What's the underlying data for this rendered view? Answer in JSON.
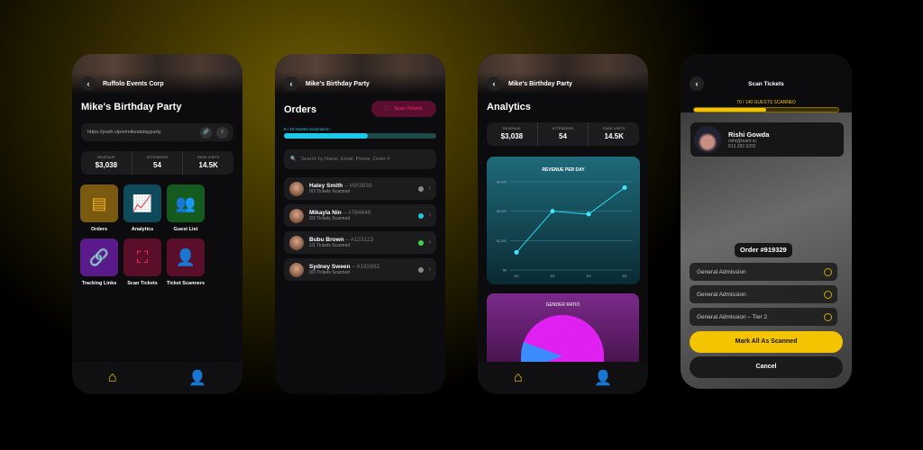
{
  "colors": {
    "accent": "#f5c400",
    "cyan": "#1fc8e8",
    "magenta": "#e020f0",
    "green": "#3ed14a"
  },
  "phone1": {
    "breadcrumb": "Ruffolo Events Corp",
    "title": "Mike's Birthday Party",
    "url": "https://posh.vip/e/mikesbdayparty",
    "stats": [
      {
        "label": "REVENUE",
        "value": "$3,038"
      },
      {
        "label": "ATTENDEES",
        "value": "54"
      },
      {
        "label": "PAGE VISITS",
        "value": "14.5K"
      }
    ],
    "tiles": [
      {
        "label": "Orders",
        "icon": "document-icon"
      },
      {
        "label": "Analytics",
        "icon": "chart-icon"
      },
      {
        "label": "Guest List",
        "icon": "people-icon"
      },
      {
        "label": "Tracking Links",
        "icon": "link-icon"
      },
      {
        "label": "Scan Tickets",
        "icon": "scan-icon"
      },
      {
        "label": "Ticket Scanners",
        "icon": "scanner-person-icon"
      }
    ]
  },
  "phone2": {
    "breadcrumb": "Mike's Birthday Party",
    "title": "Orders",
    "scan_button": "Scan Tickets",
    "progress_label": "8 / 18 Guests Scanned In",
    "progress": 0.55,
    "search_placeholder": "Search by Name, Email, Phone, Order #",
    "orders": [
      {
        "name": "Haley Smith",
        "order": "– #903939",
        "status": "0/3 Tickets Scanned",
        "dot": "#888888"
      },
      {
        "name": "Mikayla Nin",
        "order": "– #784646",
        "status": "2/3 Tickets Scanned",
        "dot": "#1fc8e8"
      },
      {
        "name": "Bubu Brown",
        "order": "– #123123",
        "status": "1/1 Tickets Scanned",
        "dot": "#3ed14a"
      },
      {
        "name": "Sydney Sween",
        "order": "– #192892",
        "status": "0/3 Tickets Scanned",
        "dot": "#888888"
      }
    ]
  },
  "phone3": {
    "breadcrumb": "Mike's Birthday Party",
    "title": "Analytics",
    "stats": [
      {
        "label": "REVENUE",
        "value": "$3,038"
      },
      {
        "label": "ATTENDEES",
        "value": "54"
      },
      {
        "label": "PAGE VISITS",
        "value": "14.5K"
      }
    ],
    "gender_title": "GENDER RATIO"
  },
  "chart_data": {
    "type": "line",
    "title": "REVENUE PER DAY",
    "categories": [
      "5/1",
      "5/2",
      "5/3",
      "5/4"
    ],
    "values": [
      600,
      2000,
      1900,
      3600
    ],
    "yticks": [
      0,
      1000,
      2000,
      4000
    ],
    "ytick_labels": [
      "$0",
      "$1,000",
      "$2,000",
      "$4,000"
    ],
    "ylim": [
      0,
      4000
    ],
    "grid": true
  },
  "phone4": {
    "title": "Scan Tickets",
    "progress_label": "70 / 140 GUESTS SCANNED",
    "progress": 0.5,
    "guest": {
      "name": "Rishi Gowda",
      "email": "rishi@team.vc",
      "phone": "813.282.9292"
    },
    "order": "Order #919329",
    "tickets": [
      "General Admission",
      "General Admission",
      "General Admission – Tier 2"
    ],
    "mark_all": "Mark All As Scanned",
    "cancel": "Cancel"
  }
}
